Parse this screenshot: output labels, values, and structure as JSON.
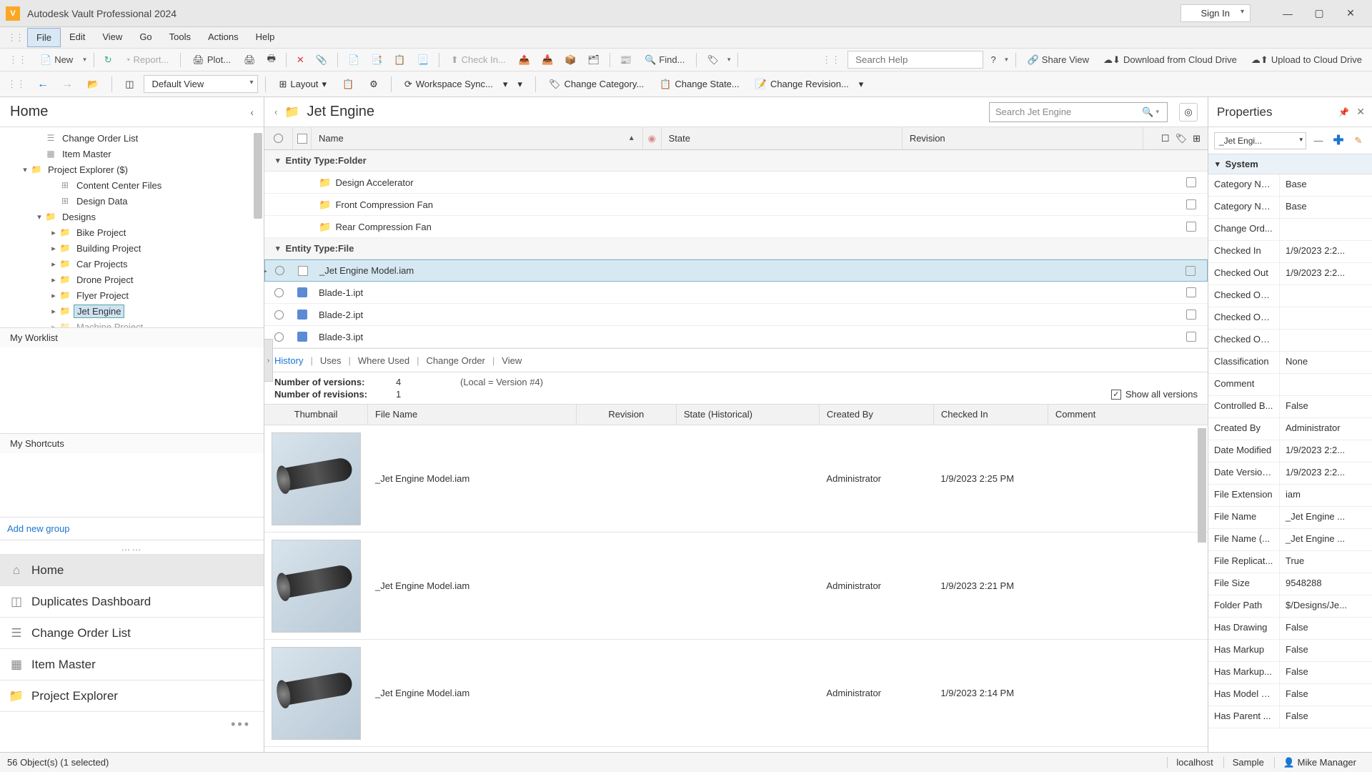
{
  "titlebar": {
    "app_title": "Autodesk Vault Professional 2024",
    "signin": "Sign In"
  },
  "menubar": {
    "items": [
      "File",
      "Edit",
      "View",
      "Go",
      "Tools",
      "Actions",
      "Help"
    ],
    "active": 0
  },
  "toolbar1": {
    "new": "New",
    "report": "Report...",
    "plot": "Plot...",
    "checkin": "Check In...",
    "find": "Find...",
    "search_placeholder": "Search Help",
    "share": "Share View",
    "download": "Download from Cloud Drive",
    "upload": "Upload to Cloud Drive"
  },
  "toolbar2": {
    "view": "Default View",
    "layout": "Layout",
    "workspace": "Workspace Sync...",
    "change_cat": "Change Category...",
    "change_state": "Change State...",
    "change_rev": "Change Revision..."
  },
  "sidebar": {
    "home_title": "Home",
    "tree": [
      {
        "indent": 1,
        "twist": "",
        "icon": "list",
        "label": "Change Order List"
      },
      {
        "indent": 1,
        "twist": "",
        "icon": "grid",
        "label": "Item Master"
      },
      {
        "indent": 0,
        "twist": "▾",
        "icon": "proj",
        "label": "Project Explorer ($)"
      },
      {
        "indent": 2,
        "twist": "",
        "icon": "lib",
        "label": "Content Center Files"
      },
      {
        "indent": 2,
        "twist": "",
        "icon": "lib",
        "label": "Design Data"
      },
      {
        "indent": 1,
        "twist": "▾",
        "icon": "folder",
        "label": "Designs"
      },
      {
        "indent": 2,
        "twist": "▸",
        "icon": "folder",
        "label": "Bike Project"
      },
      {
        "indent": 2,
        "twist": "▸",
        "icon": "folder",
        "label": "Building Project"
      },
      {
        "indent": 2,
        "twist": "▸",
        "icon": "folder",
        "label": "Car Projects"
      },
      {
        "indent": 2,
        "twist": "▸",
        "icon": "folder",
        "label": "Drone Project"
      },
      {
        "indent": 2,
        "twist": "▸",
        "icon": "folder",
        "label": "Flyer Project"
      },
      {
        "indent": 2,
        "twist": "▸",
        "icon": "folder",
        "label": "Jet Engine",
        "selected": true
      },
      {
        "indent": 2,
        "twist": "▸",
        "icon": "folder",
        "label": "Machine Project",
        "cut": true
      }
    ],
    "worklist": "My Worklist",
    "shortcuts": "My Shortcuts",
    "addgroup": "Add new group",
    "nav": [
      {
        "label": "Home",
        "active": true
      },
      {
        "label": "Duplicates Dashboard"
      },
      {
        "label": "Change Order List"
      },
      {
        "label": "Item Master"
      },
      {
        "label": "Project Explorer"
      }
    ]
  },
  "center": {
    "breadcrumb": "Jet Engine",
    "search_placeholder": "Search Jet Engine",
    "columns": {
      "name": "Name",
      "state": "State",
      "revision": "Revision"
    },
    "group1": "Entity Type:Folder",
    "folders": [
      {
        "name": "Design Accelerator"
      },
      {
        "name": "Front Compression Fan"
      },
      {
        "name": "Rear Compression Fan"
      }
    ],
    "group2": "Entity Type:File",
    "files": [
      {
        "name": "_Jet Engine Model.iam",
        "selected": true,
        "doctype": "file"
      },
      {
        "name": "Blade-1.ipt",
        "doctype": "part"
      },
      {
        "name": "Blade-2.ipt",
        "doctype": "part"
      },
      {
        "name": "Blade-3.ipt",
        "doctype": "part"
      }
    ]
  },
  "history": {
    "tabs": [
      "History",
      "Uses",
      "Where Used",
      "Change Order",
      "View"
    ],
    "active": 0,
    "num_versions_label": "Number of versions:",
    "num_versions": "4",
    "local": "(Local = Version #4)",
    "num_rev_label": "Number of revisions:",
    "num_rev": "1",
    "show_all": "Show all versions",
    "columns": {
      "thumb": "Thumbnail",
      "fn": "File Name",
      "rev": "Revision",
      "state": "State (Historical)",
      "cb": "Created By",
      "ci": "Checked In",
      "cm": "Comment"
    },
    "rows": [
      {
        "fn": "_Jet Engine Model.iam",
        "cb": "Administrator",
        "ci": "1/9/2023 2:25 PM"
      },
      {
        "fn": "_Jet Engine Model.iam",
        "cb": "Administrator",
        "ci": "1/9/2023 2:21 PM"
      },
      {
        "fn": "_Jet Engine Model.iam",
        "cb": "Administrator",
        "ci": "1/9/2023 2:14 PM"
      }
    ]
  },
  "properties": {
    "title": "Properties",
    "selector": "_Jet Engi...",
    "group": "System",
    "rows": [
      {
        "k": "Category Na...",
        "v": "Base"
      },
      {
        "k": "Category Na...",
        "v": "Base"
      },
      {
        "k": "Change Ord...",
        "v": ""
      },
      {
        "k": "Checked In",
        "v": "1/9/2023 2:2..."
      },
      {
        "k": "Checked Out",
        "v": "1/9/2023 2:2..."
      },
      {
        "k": "Checked Ou...",
        "v": ""
      },
      {
        "k": "Checked Ou...",
        "v": ""
      },
      {
        "k": "Checked Ou...",
        "v": ""
      },
      {
        "k": "Classification",
        "v": "None"
      },
      {
        "k": "Comment",
        "v": ""
      },
      {
        "k": "Controlled B...",
        "v": "False"
      },
      {
        "k": "Created By",
        "v": "Administrator"
      },
      {
        "k": "Date Modified",
        "v": "1/9/2023 2:2..."
      },
      {
        "k": "Date Version...",
        "v": "1/9/2023 2:2..."
      },
      {
        "k": "File Extension",
        "v": "iam"
      },
      {
        "k": "File Name",
        "v": "_Jet Engine ..."
      },
      {
        "k": "File Name (...",
        "v": "_Jet Engine ..."
      },
      {
        "k": "File Replicat...",
        "v": "True"
      },
      {
        "k": "File Size",
        "v": "9548288"
      },
      {
        "k": "Folder Path",
        "v": "$/Designs/Je..."
      },
      {
        "k": "Has Drawing",
        "v": "False"
      },
      {
        "k": "Has Markup",
        "v": "False"
      },
      {
        "k": "Has Markup...",
        "v": "False"
      },
      {
        "k": "Has Model S...",
        "v": "False"
      },
      {
        "k": "Has Parent ...",
        "v": "False"
      }
    ]
  },
  "statusbar": {
    "objects": "56 Object(s) (1 selected)",
    "host": "localhost",
    "db": "Sample",
    "user": "Mike Manager"
  }
}
